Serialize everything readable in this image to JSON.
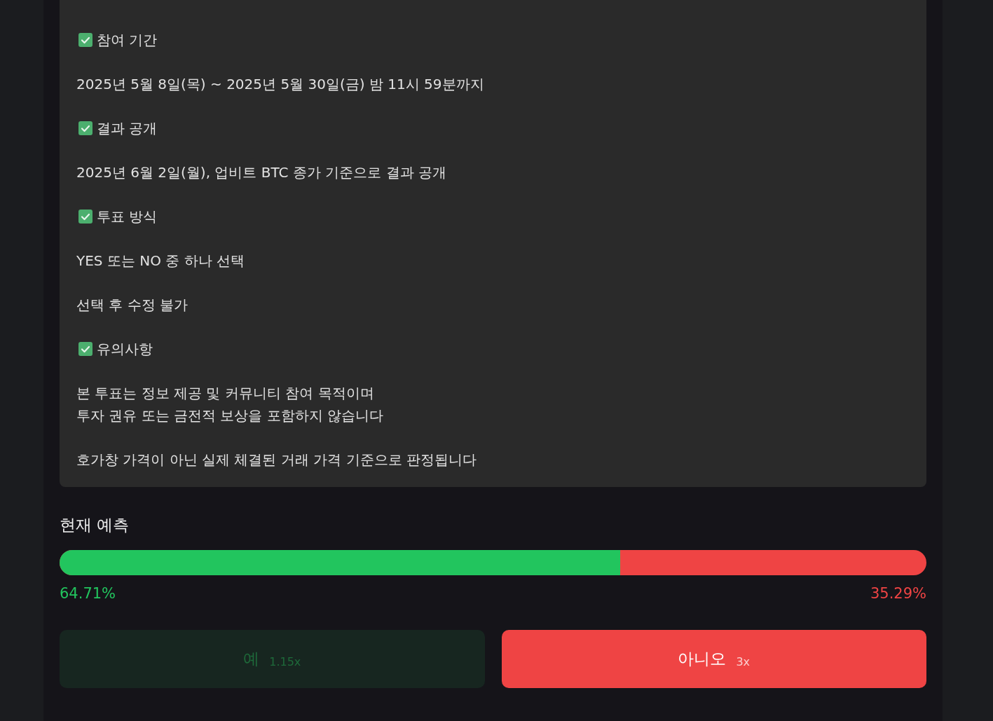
{
  "notice": [
    {
      "kind": "heading",
      "text": "참여 기간"
    },
    {
      "kind": "text",
      "lines": [
        "2025년 5월 8일(목) ~ 2025년 5월 30일(금) 밤 11시 59분까지"
      ]
    },
    {
      "kind": "heading",
      "text": "결과 공개"
    },
    {
      "kind": "text",
      "lines": [
        "2025년 6월 2일(월), 업비트 BTC 종가 기준으로 결과 공개"
      ]
    },
    {
      "kind": "heading",
      "text": "투표 방식"
    },
    {
      "kind": "text",
      "lines": [
        "YES 또는 NO 중 하나 선택"
      ]
    },
    {
      "kind": "text",
      "lines": [
        "선택 후 수정 불가"
      ]
    },
    {
      "kind": "heading",
      "text": "유의사항"
    },
    {
      "kind": "text",
      "lines": [
        "본 투표는 정보 제공 및 커뮤니티 참여 목적이며",
        "투자 권유 또는 금전적 보상을 포함하지 않습니다"
      ]
    },
    {
      "kind": "text",
      "lines": [
        "호가창 가격이 아닌 실제 체결된 거래 가격 기준으로 판정됩니다"
      ]
    }
  ],
  "prediction": {
    "title": "현재 예측",
    "level": 0.6471,
    "yes_percent": "64.71%",
    "no_percent": "35.29%"
  },
  "buttons": [
    {
      "kind": "yes",
      "label": "예",
      "odds": "1.15x",
      "selected": false
    },
    {
      "kind": "no",
      "label": "아니오",
      "odds": "3x",
      "selected": true
    }
  ]
}
